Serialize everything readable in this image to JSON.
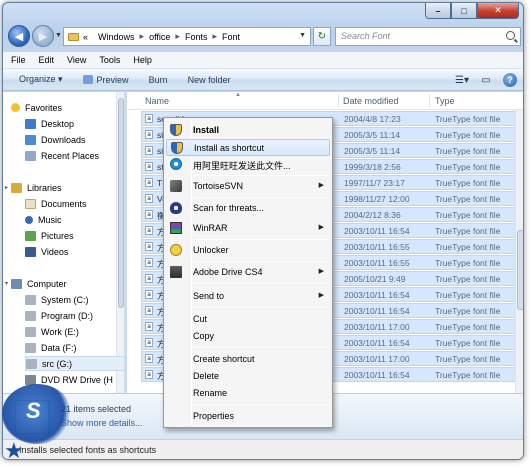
{
  "window": {
    "controls": {
      "minimize": "–",
      "maximize": "□",
      "close": "✕"
    }
  },
  "address": {
    "overflow": "«",
    "crumbs": [
      "Windows",
      "office",
      "Fonts",
      "Font"
    ],
    "search_placeholder": "Search Font"
  },
  "menubar": [
    "File",
    "Edit",
    "View",
    "Tools",
    "Help"
  ],
  "commandbar": {
    "organize": "Organize ▾",
    "preview": "Preview",
    "burn": "Burn",
    "new_folder": "New folder"
  },
  "navpane": {
    "favorites": {
      "label": "Favorites",
      "items": [
        "Desktop",
        "Downloads",
        "Recent Places"
      ]
    },
    "libraries": {
      "label": "Libraries",
      "items": [
        "Documents",
        "Music",
        "Pictures",
        "Videos"
      ]
    },
    "computer": {
      "label": "Computer",
      "items": [
        "System (C:)",
        "Program (D:)",
        "Work (E:)",
        "Data (F:)",
        "src (G:)",
        "DVD RW Drive (H"
      ]
    }
  },
  "filelist": {
    "columns": {
      "name": "Name",
      "date": "Date modified",
      "type": "Type"
    },
    "rows": [
      {
        "name": "sequihk",
        "date": "2004/4/8 17:23",
        "type": "TrueType font file"
      },
      {
        "name": "si",
        "date": "2005/3/5 11:14",
        "type": "TrueType font file"
      },
      {
        "name": "si",
        "date": "2005/3/5 11:14",
        "type": "TrueType font file"
      },
      {
        "name": "st",
        "date": "1999/3/18 2:56",
        "type": "TrueType font file"
      },
      {
        "name": "TE",
        "date": "1997/11/7 23:17",
        "type": "TrueType font file"
      },
      {
        "name": "Ve",
        "date": "1998/11/27 12:00",
        "type": "TrueType font file"
      },
      {
        "name": "衡",
        "date": "2004/2/12 8:36",
        "type": "TrueType font file"
      },
      {
        "name": "方",
        "date": "2003/10/11 16:54",
        "type": "TrueType font file"
      },
      {
        "name": "方",
        "date": "2003/10/11 16:55",
        "type": "TrueType font file"
      },
      {
        "name": "方",
        "date": "2003/10/11 16:55",
        "type": "TrueType font file"
      },
      {
        "name": "方",
        "date": "2005/10/21 9:49",
        "type": "TrueType font file"
      },
      {
        "name": "方",
        "date": "2003/10/11 16:54",
        "type": "TrueType font file"
      },
      {
        "name": "方",
        "date": "2003/10/11 16:54",
        "type": "TrueType font file"
      },
      {
        "name": "方",
        "date": "2003/10/11 17:00",
        "type": "TrueType font file"
      },
      {
        "name": "方",
        "date": "2003/10/11 16:54",
        "type": "TrueType font file"
      },
      {
        "name": "方",
        "date": "2003/10/11 17:00",
        "type": "TrueType font file"
      },
      {
        "name": "方",
        "date": "2003/10/11 16:54",
        "type": "TrueType font file"
      }
    ]
  },
  "context_menu": {
    "install": "Install",
    "install_shortcut": "Install as shortcut",
    "send_wangwang": "用阿里旺旺发送此文件...",
    "tortoisesvn": "TortoiseSVN",
    "scan": "Scan for threats...",
    "winrar": "WinRAR",
    "unlocker": "Unlocker",
    "adobe_drive": "Adobe Drive CS4",
    "send_to": "Send to",
    "cut": "Cut",
    "copy": "Copy",
    "create_shortcut": "Create shortcut",
    "delete": "Delete",
    "rename": "Rename",
    "properties": "Properties"
  },
  "details": {
    "selected": "21 items selected",
    "show_more": "Show more details..."
  },
  "statusbar": {
    "text": "Installs selected fonts as shortcuts"
  },
  "watermark": {
    "text": "S"
  }
}
